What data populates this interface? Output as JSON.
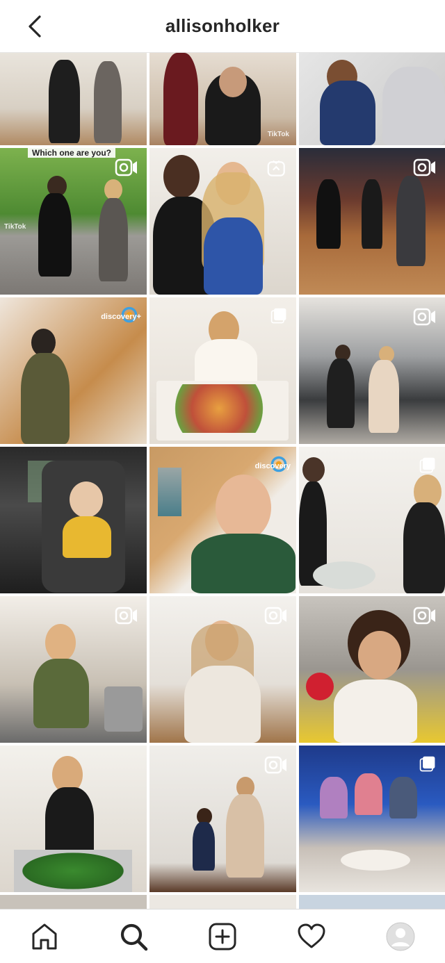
{
  "header": {
    "username": "allisonholker",
    "back_icon": "chevron-left-icon"
  },
  "tiles": [
    {
      "name": "post-1",
      "badge": "none",
      "watermark": ""
    },
    {
      "name": "post-2",
      "badge": "none",
      "watermark": "TikTok"
    },
    {
      "name": "post-3",
      "badge": "none",
      "watermark": ""
    },
    {
      "name": "post-4",
      "badge": "reel",
      "caption": "Which one are you?",
      "watermark": "TikTok"
    },
    {
      "name": "post-5",
      "badge": "igtv",
      "watermark": ""
    },
    {
      "name": "post-6",
      "badge": "reel",
      "watermark": ""
    },
    {
      "name": "post-7",
      "badge": "brand",
      "watermark": "discovery+"
    },
    {
      "name": "post-8",
      "badge": "carousel",
      "watermark": ""
    },
    {
      "name": "post-9",
      "badge": "reel",
      "watermark": ""
    },
    {
      "name": "post-10",
      "badge": "none",
      "watermark": ""
    },
    {
      "name": "post-11",
      "badge": "brand",
      "watermark": "discovery"
    },
    {
      "name": "post-12",
      "badge": "carousel",
      "watermark": ""
    },
    {
      "name": "post-13",
      "badge": "reel",
      "watermark": ""
    },
    {
      "name": "post-14",
      "badge": "reel",
      "watermark": ""
    },
    {
      "name": "post-15",
      "badge": "reel",
      "watermark": ""
    },
    {
      "name": "post-16",
      "badge": "none",
      "watermark": ""
    },
    {
      "name": "post-17",
      "badge": "reel",
      "watermark": ""
    },
    {
      "name": "post-18",
      "badge": "carousel",
      "watermark": ""
    }
  ],
  "navbar": {
    "items": [
      "home-icon",
      "search-icon",
      "new-post-icon",
      "activity-heart-icon",
      "profile-avatar"
    ],
    "active": "search-icon"
  },
  "colors": {
    "text": "#262626",
    "divider": "#dbdbdb",
    "background": "#ffffff"
  }
}
